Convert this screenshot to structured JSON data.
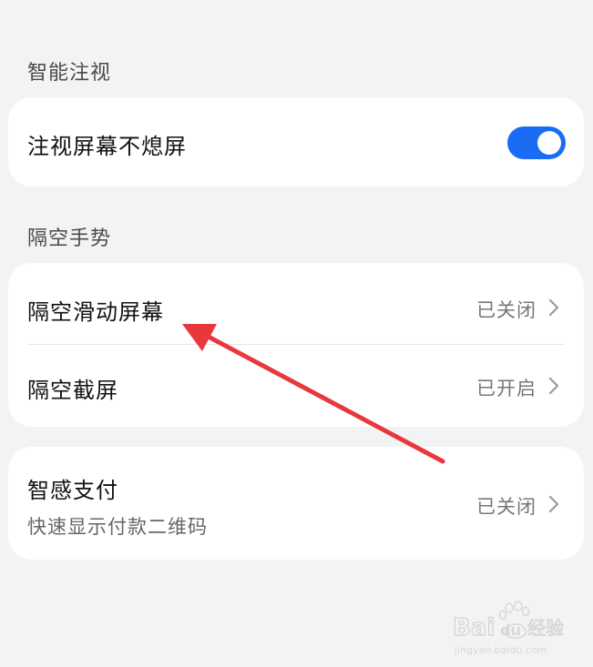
{
  "sections": {
    "gaze": {
      "title": "智能注视",
      "items": [
        {
          "label": "注视屏幕不熄屏",
          "toggle": "on"
        }
      ]
    },
    "air_gesture": {
      "title": "隔空手势",
      "items": [
        {
          "label": "隔空滑动屏幕",
          "value": "已关闭"
        },
        {
          "label": "隔空截屏",
          "value": "已开启"
        }
      ]
    },
    "smart_pay": {
      "items": [
        {
          "label": "智感支付",
          "sublabel": "快速显示付款二维码",
          "value": "已关闭"
        }
      ]
    }
  },
  "colors": {
    "background": "#f1f3f5",
    "toggle_on": "#1a6cf5",
    "annotation_arrow": "#e8383d"
  },
  "icons": {
    "chevron": "chevron-right-icon",
    "annotation": "red-arrow-annotation",
    "watermark": "baidu-jingyan-watermark"
  },
  "watermark": {
    "brand": "Baidu经验",
    "url": "jingyan.baidu.com"
  }
}
